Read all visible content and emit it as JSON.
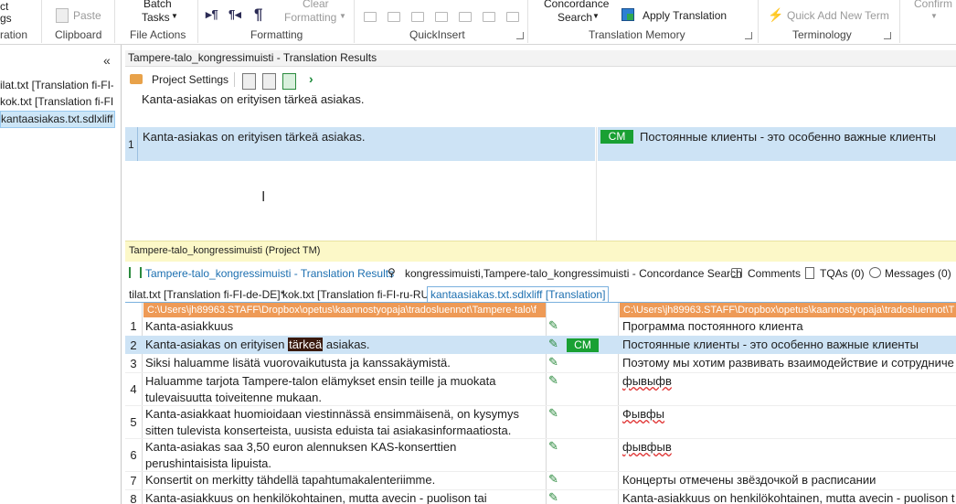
{
  "ribbon": {
    "partial_top": "ct",
    "partial_mid": "gs",
    "partial_bottom": "ration",
    "paste": "Paste",
    "clipboard": "Clipboard",
    "batch_tasks_1": "Batch",
    "batch_tasks_2": "Tasks",
    "file_actions": "File Actions",
    "clear_formatting_1": "Clear",
    "clear_formatting_2": "Formatting",
    "formatting": "Formatting",
    "quickinsert": "QuickInsert",
    "concordance_1": "Concordance",
    "concordance_2": "Search",
    "apply_translation": "Apply Translation",
    "translation_memory": "Translation Memory",
    "quick_add_new_term": "Quick Add New Term",
    "terminology": "Terminology",
    "confirm": "Confirm"
  },
  "left_panel": {
    "collapse": "«",
    "items": [
      "ilat.txt [Translation fi-FI-d",
      "kok.txt [Translation fi-FI-r",
      "kantaasiakas.txt.sdlxliff [T"
    ]
  },
  "results": {
    "title": "Tampere-talo_kongressimuisti - Translation Results",
    "project_settings": "Project Settings",
    "source_preview": "Kanta-asiakas on erityisen tärkeä asiakas.",
    "row_num": "1",
    "row_source": "Kanta-asiakas on erityisen tärkeä asiakas.",
    "row_badge": "CM",
    "row_target": "Постоянные клиенты - это особенно важные клиенты",
    "tm_name": "Tampere-talo_kongressimuisti (Project TM)"
  },
  "bottom_tabs": [
    "Tampere-talo_kongressimuisti - Translation Results",
    "kongressimuisti,Tampere-talo_kongressimuisti - Concordance Search",
    "Comments",
    "TQAs (0)",
    "Messages (0)"
  ],
  "doc_tabs": [
    "tilat.txt [Translation fi-FI-de-DE]*",
    "kok.txt [Translation fi-FI-ru-RU]",
    "kantaasiakas.txt.sdlxliff [Translation]"
  ],
  "editor": {
    "src_path": "C:\\Users\\jh89963.STAFF\\Dropbox\\opetus\\kaannostyopaja\\tradosluennot\\Tampere-talo\\f",
    "tgt_path": "C:\\Users\\jh89963.STAFF\\Dropbox\\opetus\\kaannostyopaja\\tradosluennot\\T",
    "rows": [
      {
        "num": "1",
        "src": "Kanta-asiakkuus",
        "tgt": "Программа постоянного клиента"
      },
      {
        "num": "2",
        "src_a": "Kanta-asiakas on erityisen ",
        "src_hl": "tärkeä",
        "src_b": " asiakas.",
        "badge": "CM",
        "tgt": "Постоянные клиенты - это особенно важные клиенты"
      },
      {
        "num": "3",
        "src": "Siksi haluamme lisätä vuorovaikutusta ja kanssakäymistä.",
        "tgt": "Поэтому мы хотим развивать взаимодействие и сотрудниче"
      },
      {
        "num": "4",
        "src": "Haluamme tarjota Tampere-talon elämykset ensin teille ja muokata tulevaisuutta toiveitenne mukaan.",
        "tgt": "фывыфв"
      },
      {
        "num": "5",
        "src": "Kanta-asiakkaat huomioidaan viestinnässä ensimmäisenä, on kysymys sitten tulevista konserteista, uusista eduista tai asiakasinformaatiosta.",
        "tgt": "Фывфы"
      },
      {
        "num": "6",
        "src": "Kanta-asiakas saa 3,50 euron alennuksen KAS-konserttien perushintaisista lipuista.",
        "tgt": "фывфыв"
      },
      {
        "num": "7",
        "src": "Konsertit on merkitty tähdellä tapahtumakalenteriimme.",
        "tgt": "Концерты отмечены звёздочкой в расписании"
      },
      {
        "num": "8",
        "src": "Kanta-asiakkuus on henkilökohtainen, mutta avecin - puolison tai",
        "tgt": "Kanta-asiakkuus on henkilökohtainen, mutta avecin - puolison t"
      }
    ]
  },
  "colors": {
    "accent": "#19a033",
    "selection": "#cde3f5",
    "tm_bar": "#fcf8c8",
    "path_bar": "#ee9a56"
  }
}
